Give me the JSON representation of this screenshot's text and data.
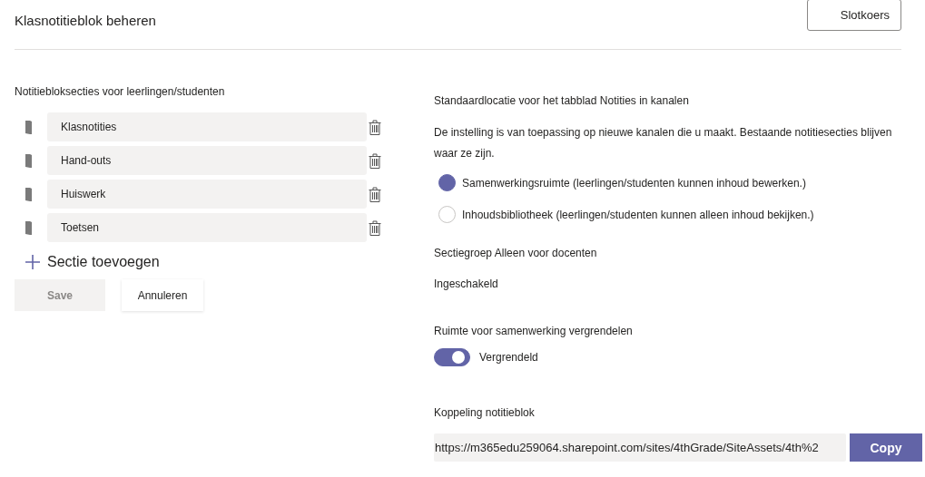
{
  "header": {
    "title": "Klasnotitieblok beheren",
    "button": "Slotkoers"
  },
  "sections": {
    "heading": "Notitiebloksecties voor leerlingen/studenten",
    "items": [
      {
        "name": "Klasnotities"
      },
      {
        "name": "Hand-outs"
      },
      {
        "name": "Huiswerk"
      },
      {
        "name": "Toetsen"
      }
    ],
    "add_label": "Sectie toevoegen"
  },
  "actions": [
    {
      "label": "Save",
      "disabled": true
    },
    {
      "label": "Annuleren",
      "disabled": false
    }
  ],
  "location": {
    "heading": "Standaardlocatie voor het tabblad Notities in kanalen",
    "description": "De instelling is van toepassing op nieuwe kanalen die u maakt. Bestaande notitiesecties blijven waar ze zijn.",
    "options": [
      {
        "label": "Samenwerkingsruimte (leerlingen/studenten kunnen inhoud bewerken.)",
        "selected": true
      },
      {
        "label": "Inhoudsbibliotheek (leerlingen/studenten kunnen alleen inhoud bekijken.)",
        "selected": false
      }
    ]
  },
  "teacher_group": {
    "heading": "Sectiegroep Alleen voor docenten",
    "value": "Ingeschakeld"
  },
  "lock": {
    "heading": "Ruimte voor samenwerking vergrendelen",
    "on": true,
    "label": "Vergrendeld"
  },
  "link": {
    "heading": "Koppeling notitieblok",
    "value": "https://m365edu259064.sharepoint.com/sites/4thGrade/SiteAssets/4th%2",
    "button": "Copy"
  }
}
